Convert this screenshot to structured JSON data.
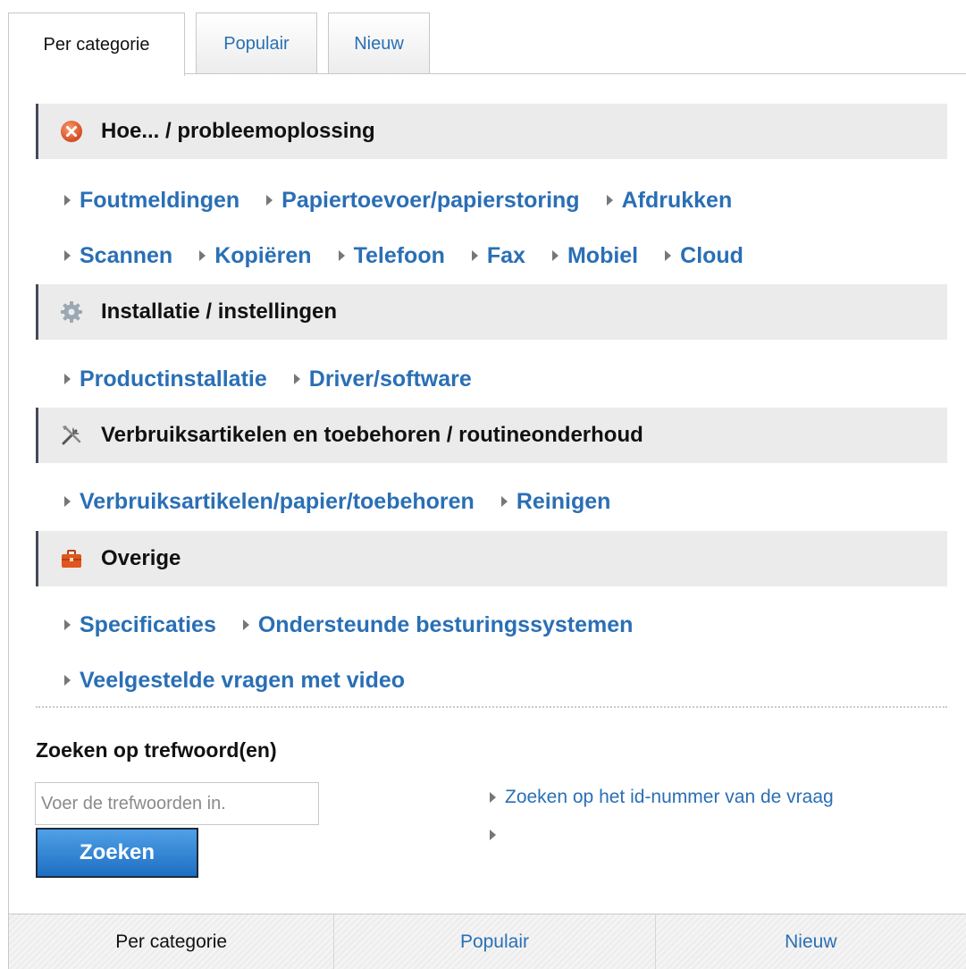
{
  "tabs": [
    {
      "label": "Per categorie",
      "active": true
    },
    {
      "label": "Populair",
      "active": false
    },
    {
      "label": "Nieuw",
      "active": false
    }
  ],
  "sections": [
    {
      "title": "Hoe... / probleemoplossing",
      "icon": "error-icon",
      "rows": [
        [
          "Foutmeldingen",
          "Papiertoevoer/papierstoring",
          "Afdrukken"
        ],
        [
          "Scannen",
          "Kopiëren",
          "Telefoon",
          "Fax",
          "Mobiel",
          "Cloud"
        ]
      ]
    },
    {
      "title": "Installatie / instellingen",
      "icon": "gear-icon",
      "rows": [
        [
          "Productinstallatie",
          "Driver/software"
        ]
      ]
    },
    {
      "title": "Verbruiksartikelen en toebehoren / routineonderhoud",
      "icon": "tools-icon",
      "rows": [
        [
          "Verbruiksartikelen/papier/toebehoren",
          "Reinigen"
        ]
      ]
    },
    {
      "title": "Overige",
      "icon": "toolbox-icon",
      "rows": [
        [
          "Specificaties",
          "Ondersteunde besturingssystemen"
        ],
        [
          "Veelgestelde vragen met video"
        ]
      ]
    }
  ],
  "search": {
    "title": "Zoeken op trefwoord(en)",
    "placeholder": "Voer de trefwoorden in.",
    "button_label": "Zoeken",
    "side_links": [
      "Zoeken op het id-nummer van de vraag",
      ""
    ]
  },
  "bottom_tabs": [
    {
      "label": "Per categorie",
      "active": true
    },
    {
      "label": "Populair",
      "active": false
    },
    {
      "label": "Nieuw",
      "active": false
    }
  ],
  "colors": {
    "link": "#2a6fb5",
    "header_bg": "#ebebeb",
    "header_bar": "#444b5a",
    "button": "#2f86d8"
  }
}
